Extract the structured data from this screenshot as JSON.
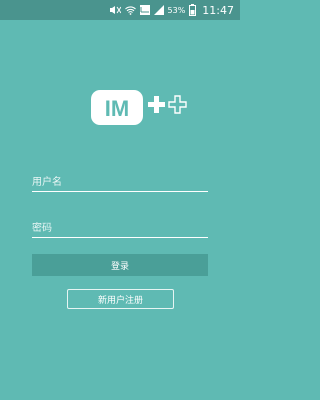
{
  "status_bar": {
    "battery_percent": "53%",
    "time": "11:47",
    "icons": [
      "mute-icon",
      "wifi-icon",
      "signal-4g-icon",
      "signal-icon",
      "battery-icon"
    ]
  },
  "logo": {
    "text": "IM",
    "suffix": "++"
  },
  "form": {
    "username_placeholder": "用户名",
    "password_placeholder": "密码",
    "login_label": "登录",
    "register_label": "新用户注册"
  },
  "colors": {
    "background": "#5fbab3",
    "status_bar": "#4a948e",
    "login_button": "#4a9f98",
    "text": "#ffffff"
  }
}
